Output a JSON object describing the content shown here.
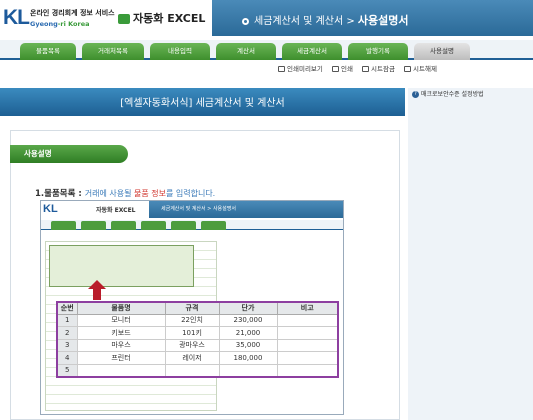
{
  "header": {
    "logo": "KL",
    "org_line1": "온라인 경리회계 정보 서비스",
    "org_line2_prefix": "Gyeong",
    "org_line2_rest": "-ri Korea",
    "product": "자동화 EXCEL",
    "page_path_prefix": "세금계산서 및 계산서",
    "page_path_sep": " > ",
    "page_title": "사용설명서"
  },
  "nav": [
    "물품목록",
    "거래처목록",
    "내용입력",
    "계산서",
    "세금계산서",
    "발행기록",
    "사용설명"
  ],
  "toolbar": [
    "인쇄미리보기",
    "인쇄",
    "시트잠금",
    "시트해제"
  ],
  "banner": "[엑셀자동화서식] 세금계산서 및 계산서",
  "sidebar_link": "매크로보안수준 설정방법",
  "section_title": "사용설명",
  "step": {
    "num": "1.물품목록 : ",
    "t1": "거래에 사용될 ",
    "t2": "물품 정보",
    "t3": "를 입력합니다."
  },
  "screenshot": {
    "logo": "KL",
    "product": "자동화 EXCEL",
    "path": "세금계산서 및 계산서 > 사용설명서"
  },
  "table": {
    "headers": [
      "순번",
      "물품명",
      "규격",
      "단가",
      "비고"
    ],
    "rows": [
      [
        "1",
        "모니터",
        "22인치",
        "230,000",
        ""
      ],
      [
        "2",
        "키보드",
        "101키",
        "21,000",
        ""
      ],
      [
        "3",
        "마우스",
        "광마우스",
        "35,000",
        ""
      ],
      [
        "4",
        "프린터",
        "레이저",
        "180,000",
        ""
      ],
      [
        "5",
        "",
        "",
        "",
        ""
      ]
    ]
  },
  "colors": {
    "header_blue": "#2b6a98",
    "tab_green": "#3e8f2d",
    "arrow_red": "#b91c2a",
    "highlight_purple": "#8d3fa0"
  }
}
